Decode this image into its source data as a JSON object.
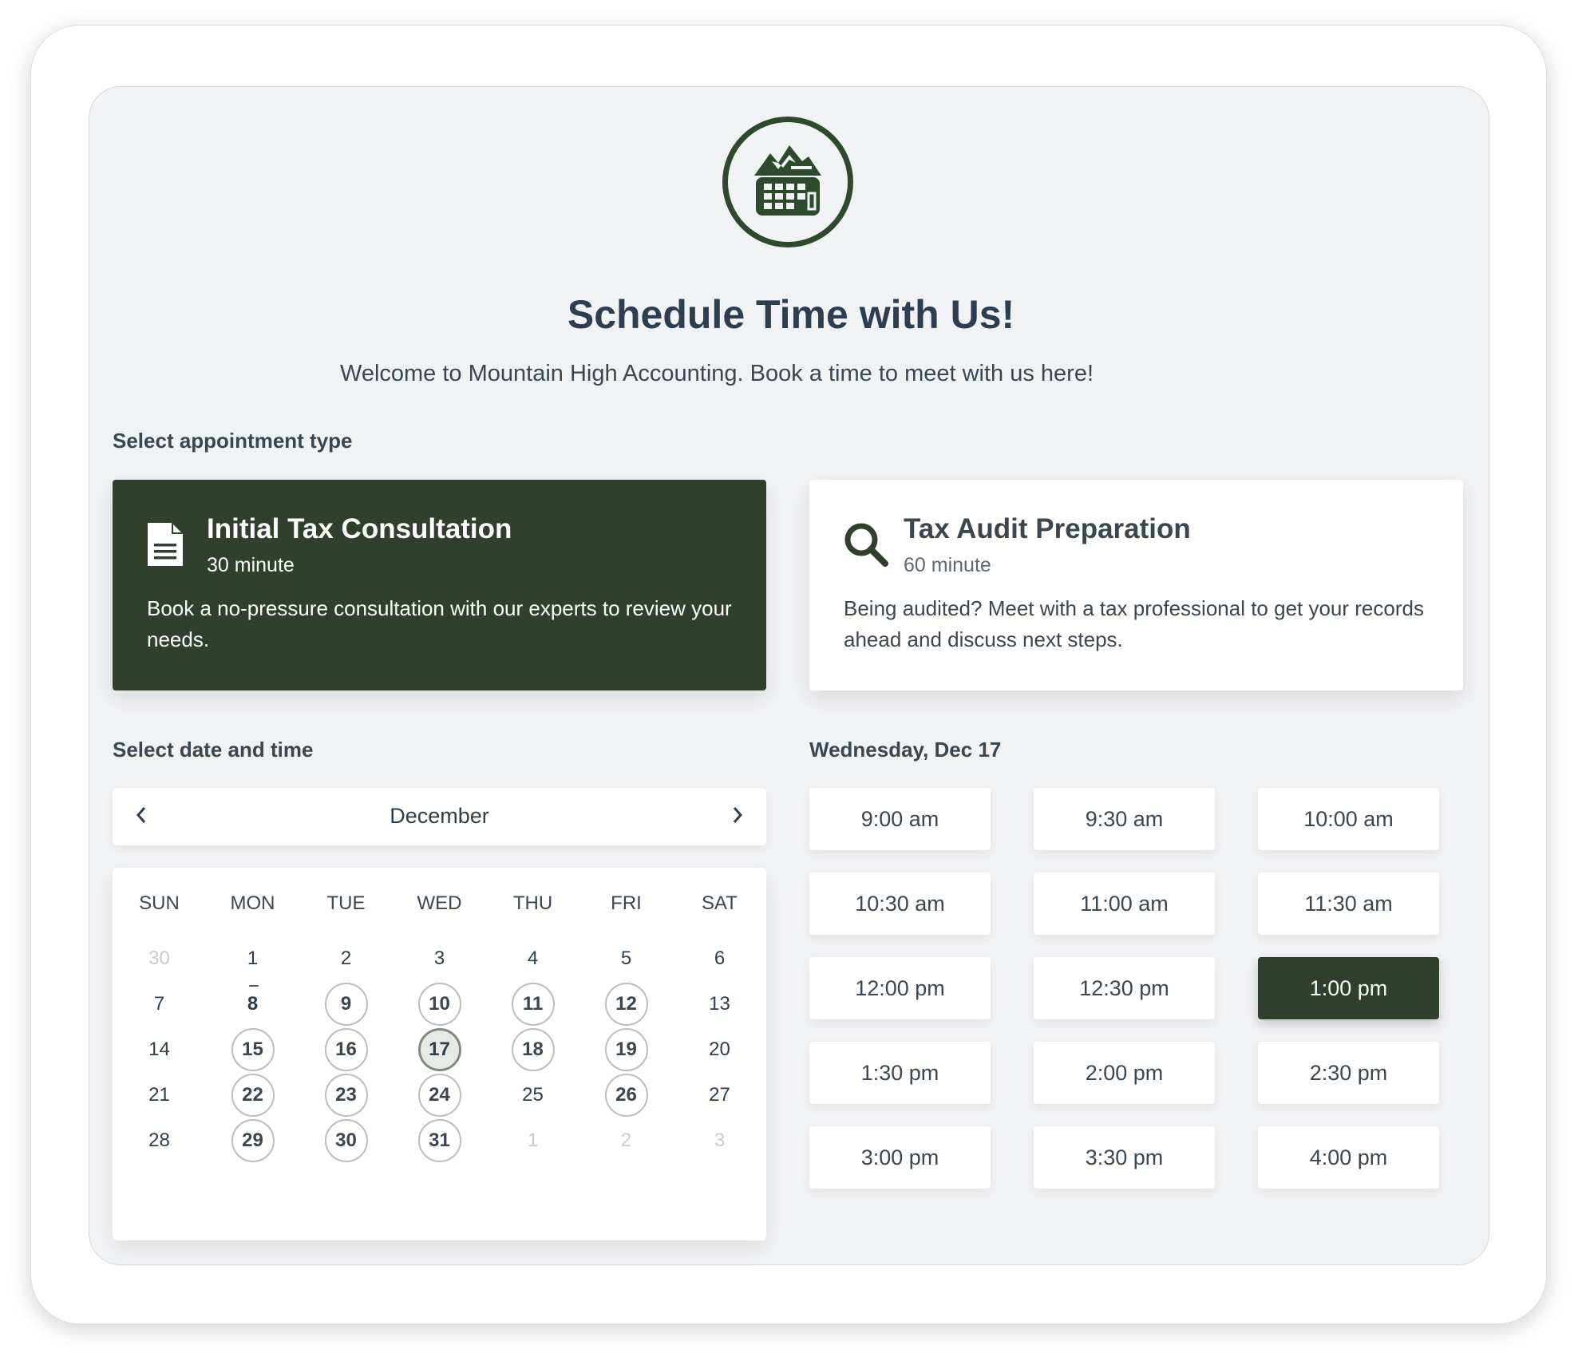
{
  "header": {
    "title": "Schedule Time with Us!",
    "subtitle": "Welcome to Mountain High Accounting. Book a time to meet with us here!",
    "logo_icon": "mountain-calendar-icon"
  },
  "appointment": {
    "label": "Select appointment type",
    "types": [
      {
        "title": "Initial Tax Consultation",
        "duration": "30 minute",
        "description": "Book a no-pressure consultation with our experts to review your needs.",
        "icon": "document-icon",
        "selected": true
      },
      {
        "title": "Tax Audit Preparation",
        "duration": "60 minute",
        "description": "Being audited? Meet with a tax professional to get your records ahead and discuss next steps.",
        "icon": "search-icon",
        "selected": false
      }
    ]
  },
  "calendar": {
    "label": "Select date and time",
    "month": "December",
    "weekdays": [
      "SUN",
      "MON",
      "TUE",
      "WED",
      "THU",
      "FRI",
      "SAT"
    ],
    "weeks": [
      [
        {
          "d": "30",
          "s": "muted"
        },
        {
          "d": "1",
          "s": "plain"
        },
        {
          "d": "2",
          "s": "plain"
        },
        {
          "d": "3",
          "s": "plain"
        },
        {
          "d": "4",
          "s": "plain"
        },
        {
          "d": "5",
          "s": "plain"
        },
        {
          "d": "6",
          "s": "plain"
        }
      ],
      [
        {
          "d": "7",
          "s": "plain"
        },
        {
          "d": "8",
          "s": "today"
        },
        {
          "d": "9",
          "s": "avail"
        },
        {
          "d": "10",
          "s": "avail"
        },
        {
          "d": "11",
          "s": "avail"
        },
        {
          "d": "12",
          "s": "avail"
        },
        {
          "d": "13",
          "s": "plain"
        }
      ],
      [
        {
          "d": "14",
          "s": "plain"
        },
        {
          "d": "15",
          "s": "avail"
        },
        {
          "d": "16",
          "s": "avail"
        },
        {
          "d": "17",
          "s": "sel"
        },
        {
          "d": "18",
          "s": "avail"
        },
        {
          "d": "19",
          "s": "avail"
        },
        {
          "d": "20",
          "s": "plain"
        }
      ],
      [
        {
          "d": "21",
          "s": "plain"
        },
        {
          "d": "22",
          "s": "avail"
        },
        {
          "d": "23",
          "s": "avail"
        },
        {
          "d": "24",
          "s": "avail"
        },
        {
          "d": "25",
          "s": "plain"
        },
        {
          "d": "26",
          "s": "avail"
        },
        {
          "d": "27",
          "s": "plain"
        }
      ],
      [
        {
          "d": "28",
          "s": "plain"
        },
        {
          "d": "29",
          "s": "avail"
        },
        {
          "d": "30",
          "s": "avail"
        },
        {
          "d": "31",
          "s": "avail"
        },
        {
          "d": "1",
          "s": "muted"
        },
        {
          "d": "2",
          "s": "muted"
        },
        {
          "d": "3",
          "s": "muted"
        }
      ]
    ]
  },
  "times": {
    "date_label": "Wednesday, Dec 17",
    "selected": "1:00 pm",
    "slots": [
      "9:00 am",
      "9:30 am",
      "10:00 am",
      "10:30 am",
      "11:00 am",
      "11:30 am",
      "12:00 pm",
      "12:30 pm",
      "1:00 pm",
      "1:30 pm",
      "2:00 pm",
      "2:30 pm",
      "3:00 pm",
      "3:30 pm",
      "4:00 pm"
    ]
  },
  "colors": {
    "brand_green": "#30402d",
    "logo_green": "#2d4a2c",
    "panel_bg": "#f1f2f4",
    "text_dark": "#2c3e50"
  }
}
